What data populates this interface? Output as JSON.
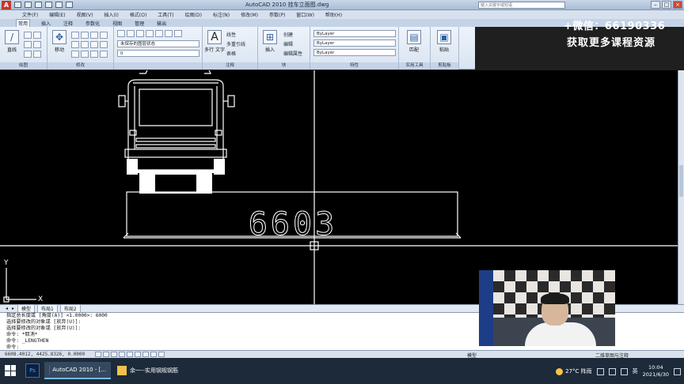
{
  "window": {
    "title": "AutoCAD 2010    挂车立面图.dwg",
    "search_placeholder": "键入关键字或短语",
    "controls": [
      "–",
      "□",
      "×"
    ]
  },
  "menubar": [
    "文件(F)",
    "编辑(E)",
    "视图(V)",
    "插入(I)",
    "格式(O)",
    "工具(T)",
    "绘图(D)",
    "标注(N)",
    "修改(M)",
    "参数(P)",
    "窗口(W)",
    "帮助(H)"
  ],
  "ribbon_tabs": [
    "常用",
    "插入",
    "注释",
    "参数化",
    "视图",
    "管理",
    "输出"
  ],
  "ribbon": {
    "panels": {
      "draw": "绘图",
      "modify": "修改",
      "annotation": "注释",
      "block": "块",
      "properties": "特性",
      "utilities": "实用工具",
      "clipboard": "剪贴板"
    },
    "big_buttons": {
      "line": "直线",
      "move": "移动",
      "mtext": "多行\n文字",
      "insert": "插入",
      "match": "匹配",
      "paste": "粘贴"
    },
    "layer_state": "未保存的图层状态",
    "layer_current": "0",
    "annotation_items": [
      "线性",
      "多重引线",
      "表格"
    ],
    "block_items": [
      "创建",
      "编辑",
      "编辑属性"
    ],
    "property_rows": [
      "ByLayer",
      "ByLayer",
      "ByLayer"
    ]
  },
  "promo": {
    "wechat": "+微信：66190336",
    "course": "获取更多课程资源"
  },
  "drawing": {
    "plate_text": "6603",
    "ucs_x": "X",
    "ucs_y": "Y"
  },
  "layout_tabs": [
    "模型",
    "布局1",
    "布局2"
  ],
  "command_lines": [
    "指定总长度或 [角度(A)] <1.0000>: 6000",
    "选择要修改的对象或 [放弃(U)]:",
    "选择要修改的对象或 [放弃(U)]:",
    "命令: *取消*",
    "命令: _LENGTHEN",
    "命令:"
  ],
  "statusbar": {
    "coords": "6608.4012,  4425.8326,  0.0000",
    "model": "模型",
    "workspace": "二维草图与注释"
  },
  "taskbar": {
    "ps_label": "Ps",
    "apps": [
      "AutoCAD 2010 - [...",
      "余一--实用钢规钢筋"
    ],
    "weather": "27°C 阵雨",
    "ime": "英",
    "time": "10:04",
    "date": "2021/6/30"
  }
}
